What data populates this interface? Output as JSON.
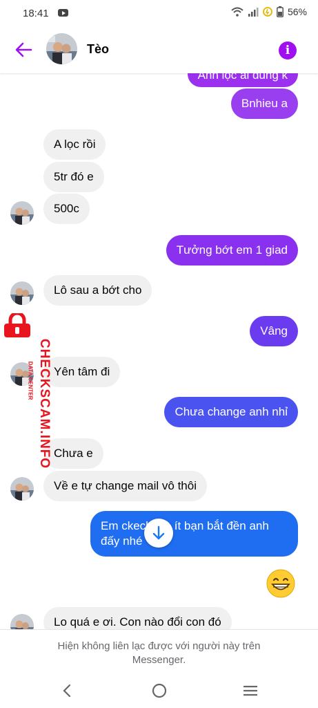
{
  "status": {
    "time": "18:41",
    "battery": "56%"
  },
  "header": {
    "name": "Tèo"
  },
  "messages": [
    {
      "text": "Anh lọc ai dùng k"
    },
    {
      "text": "Bnhieu a"
    },
    {
      "text": "A lọc rồi"
    },
    {
      "text": "5tr đó e"
    },
    {
      "text": "500c"
    },
    {
      "text": "Tưởng bớt em 1 giad"
    },
    {
      "text": "Lô sau a bớt cho"
    },
    {
      "text": "Vâng"
    },
    {
      "text": "Yên tâm đi"
    },
    {
      "text": "Chưa change anh nhỉ"
    },
    {
      "text": "Chưa e"
    },
    {
      "text": "Về e tự change mail vô thôi"
    },
    {
      "text": "Em ckeck mà ít bạn bắt đền anh"
    },
    {
      "text": "đấy nhé"
    },
    {
      "text": "Lo quá e ơi. Con nào đổi con đó"
    }
  ],
  "watermark": {
    "text": "CHECKSCAM.INFO",
    "sub": "DATA CENTER"
  },
  "notice": {
    "line1": "Hiện không liên lạc được với người này trên",
    "line2": "Messenger."
  },
  "colors": {
    "accent": "#a00ff0",
    "blue": "#1877f2",
    "purple": "#8a2be2"
  }
}
